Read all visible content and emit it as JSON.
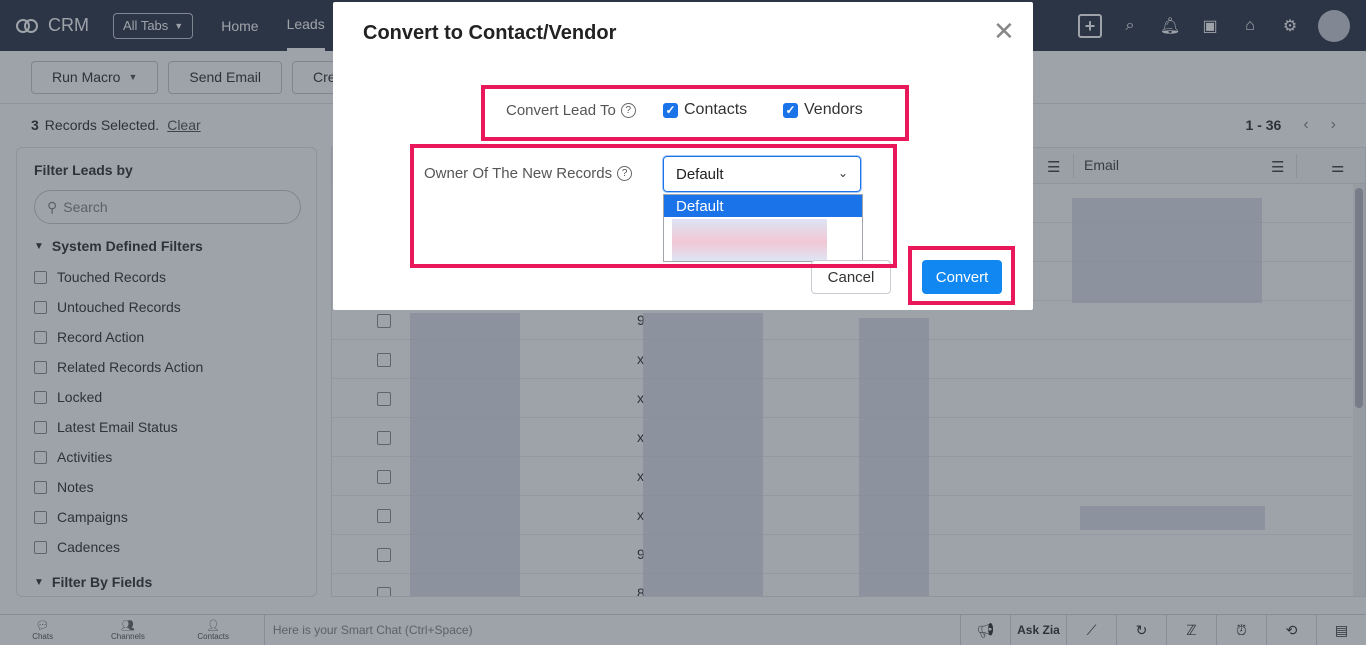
{
  "topbar": {
    "app_name": "CRM",
    "all_tabs_label": "All Tabs",
    "nav": [
      "Home",
      "Leads"
    ]
  },
  "toolbar": {
    "run_macro": "Run Macro",
    "send_email": "Send Email",
    "create_partial": "Cre"
  },
  "selection": {
    "count": "3",
    "label": "Records Selected.",
    "clear": "Clear"
  },
  "pager": {
    "range": "1 - 36"
  },
  "sidebar": {
    "title": "Filter Leads by",
    "search_placeholder": "Search",
    "system_group": "System Defined Filters",
    "filters": [
      "Touched Records",
      "Untouched Records",
      "Record Action",
      "Related Records Action",
      "Locked",
      "Latest Email Status",
      "Activities",
      "Notes",
      "Campaigns",
      "Cadences"
    ],
    "fields_group": "Filter By Fields"
  },
  "grid": {
    "email_header": "Email",
    "row_prefixes": [
      "9",
      "x",
      "x",
      "x",
      "x",
      "x",
      "9",
      "8"
    ]
  },
  "footer": {
    "chats": "Chats",
    "channels": "Channels",
    "contacts": "Contacts",
    "smart_chat": "Here is your Smart Chat (Ctrl+Space)",
    "ask_zia": "Ask Zia"
  },
  "modal": {
    "title": "Convert to Contact/Vendor",
    "convert_lead_to_label": "Convert Lead To",
    "option_contacts": "Contacts",
    "option_vendors": "Vendors",
    "owner_label": "Owner Of The New Records",
    "owner_value": "Default",
    "dropdown_selected": "Default",
    "cancel": "Cancel",
    "convert": "Convert"
  },
  "colors": {
    "highlight": "#e8185a",
    "primary": "#1187f2",
    "topbar": "#313949"
  }
}
